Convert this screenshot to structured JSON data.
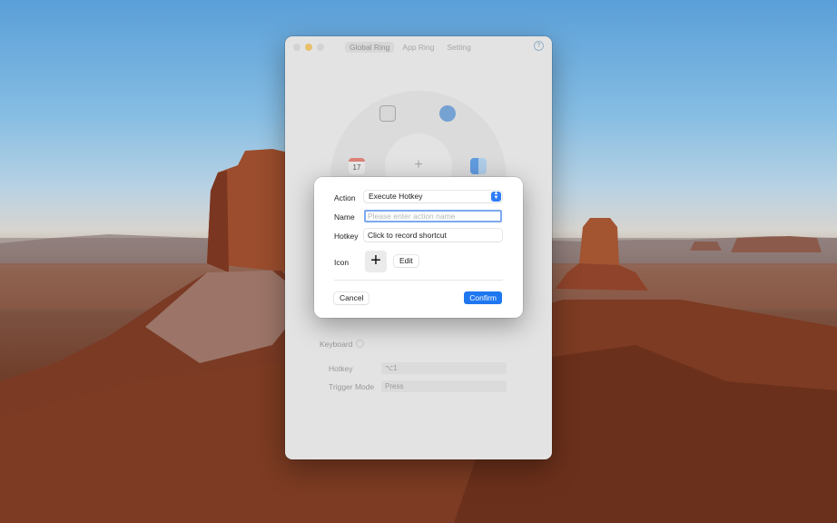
{
  "window": {
    "tabs": [
      {
        "label": "Global Ring",
        "active": true
      },
      {
        "label": "App Ring",
        "active": false
      },
      {
        "label": "Setting",
        "active": false
      }
    ],
    "help_glyph": "?",
    "ring": {
      "center_glyph": "+",
      "calendar_day": "17"
    },
    "keyboard": {
      "section_label": "Keyboard",
      "hotkey_label": "Hotkey",
      "hotkey_value": "⌥1",
      "trigger_label": "Trigger Mode",
      "trigger_value": "Press"
    }
  },
  "dialog": {
    "action_label": "Action",
    "action_value": "Execute Hotkey",
    "name_label": "Name",
    "name_placeholder": "Please enter action name",
    "hotkey_label": "Hotkey",
    "hotkey_value": "Click to record shortcut",
    "icon_label": "Icon",
    "icon_glyph": "+",
    "edit_label": "Edit",
    "cancel_label": "Cancel",
    "confirm_label": "Confirm"
  },
  "colors": {
    "accent": "#1f77f0",
    "traffic_min": "#f4bf4f"
  }
}
